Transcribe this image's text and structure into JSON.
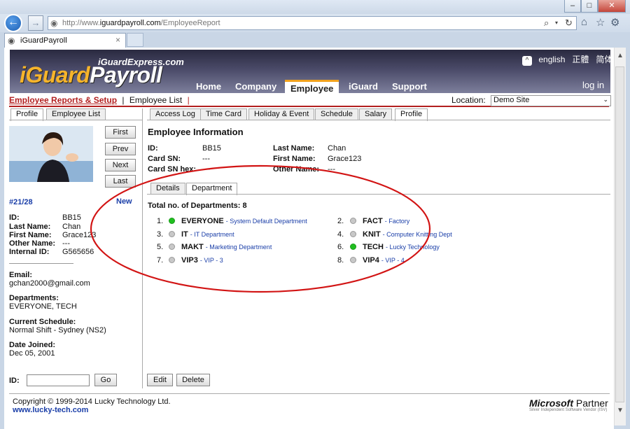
{
  "browser": {
    "url_prefix": "http://www.",
    "url_domain": "iguardpayroll.com",
    "url_path": "/EmployeeReport",
    "tab_title": "iGuardPayroll",
    "search_icon": "search-icon",
    "refresh_icon": "refresh-icon"
  },
  "banner": {
    "subtitle": "iGuardExpress.com",
    "logo_left": "iGuard",
    "logo_right": "Payroll",
    "nav": [
      "Home",
      "Company",
      "Employee",
      "iGuard",
      "Support"
    ],
    "lang_en": "english",
    "lang_tc": "正體",
    "lang_sc": "简体",
    "login": "log in"
  },
  "breadcrumb": {
    "section": "Employee Reports & Setup",
    "separator": "|",
    "page": "Employee List",
    "location_label": "Location:",
    "location_value": "Demo Site"
  },
  "left": {
    "tabs": [
      "Profile",
      "Employee List"
    ],
    "buttons": [
      "First",
      "Prev",
      "Next",
      "Last"
    ],
    "record": "#21/28",
    "new": "New",
    "fields": [
      {
        "label": "ID:",
        "value": "BB15"
      },
      {
        "label": "Last Name:",
        "value": "Chan"
      },
      {
        "label": "First Name:",
        "value": "Grace123"
      },
      {
        "label": "Other Name:",
        "value": "---"
      },
      {
        "label": "Internal ID:",
        "value": "G565656"
      }
    ],
    "email_label": "Email:",
    "email": "gchan2000@gmail.com",
    "depts_label": "Departments:",
    "depts": "EVERYONE, TECH",
    "sched_label": "Current Schedule:",
    "sched": "Normal Shift - Sydney (NS2)",
    "joined_label": "Date Joined:",
    "joined": "Dec 05, 2001",
    "id_label": "ID:",
    "go": "Go"
  },
  "right": {
    "tabs": [
      "Access Log",
      "Time Card",
      "Holiday & Event",
      "Schedule",
      "Salary",
      "Profile"
    ],
    "heading": "Employee Information",
    "id_label": "ID:",
    "id": "BB15",
    "cardsn_label": "Card SN:",
    "cardsn": "---",
    "cardsnhex_label": "Card SN hex:",
    "cardsnhex": "---",
    "lastname_label": "Last Name:",
    "lastname": "Chan",
    "firstname_label": "First Name:",
    "firstname": "Grace123",
    "othername_label": "Other Name:",
    "othername": "---",
    "subtabs": [
      "Details",
      "Department"
    ],
    "total": "Total no. of Departments: 8",
    "departments": [
      {
        "num": "1.",
        "code": "EVERYONE",
        "desc": "- System Default Department",
        "active": true
      },
      {
        "num": "2.",
        "code": "FACT",
        "desc": "- Factory",
        "active": false
      },
      {
        "num": "3.",
        "code": "IT",
        "desc": "- IT Department",
        "active": false
      },
      {
        "num": "4.",
        "code": "KNIT",
        "desc": "- Computer Knitting Dept",
        "active": false
      },
      {
        "num": "5.",
        "code": "MAKT",
        "desc": "- Marketing Department",
        "active": false
      },
      {
        "num": "6.",
        "code": "TECH",
        "desc": "- Lucky Technology",
        "active": true
      },
      {
        "num": "7.",
        "code": "VIP3",
        "desc": "- VIP - 3",
        "active": false
      },
      {
        "num": "8.",
        "code": "VIP4",
        "desc": "- VIP - 4",
        "active": false
      }
    ],
    "edit": "Edit",
    "delete": "Delete"
  },
  "footer": {
    "copyright": "Copyright © 1999-2014 Lucky Technology Ltd.",
    "link": "www.lucky-tech.com",
    "ms": "Microsoft",
    "partner": "Partner",
    "ms_sub": "Silver Independent Software Vendor (ISV)"
  },
  "colors": {
    "active_dot": "#1fbf1f",
    "inactive_dot": "#c8c8c8",
    "annotation": "#d21414"
  }
}
